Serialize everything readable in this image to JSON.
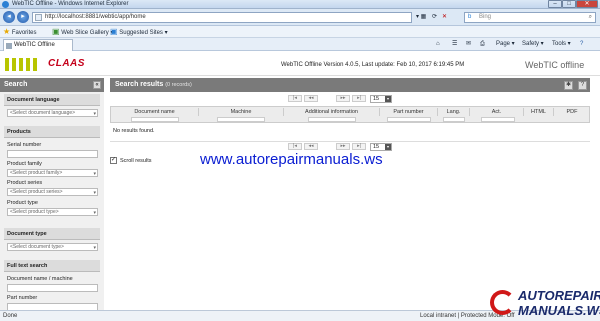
{
  "browser": {
    "title": "WebTIC Offline - Windows Internet Explorer",
    "url": "http://localhost:8881/webtic/app/home",
    "search_placeholder": "Bing",
    "favorites_label": "Favorites",
    "fav_items": [
      "Web Slice Gallery ▾",
      "Suggested Sites ▾"
    ],
    "tab_label": "WebTIC Offline",
    "tools": [
      "Page ▾",
      "Safety ▾",
      "Tools ▾",
      "?"
    ],
    "status_left": "Done",
    "status_right": "Local intranet | Protected Mode: Off"
  },
  "app": {
    "brand": "CLAAS",
    "version_line": "WebTIC Offline Version 4.0.5, Last update: Feb 10, 2017 6:19:45 PM",
    "product_name": "WebTIC offline"
  },
  "sidebar": {
    "title": "Search",
    "collapse_btn": "«",
    "sections": {
      "doc_language": {
        "title": "Document language",
        "select": "<Select document language>"
      },
      "products": {
        "title": "Products",
        "serial_label": "Serial number",
        "family_label": "Product family",
        "family_select": "<Select product family>",
        "series_label": "Product series",
        "series_select": "<Select product series>",
        "type_label": "Product type",
        "type_select": "<Select product type>"
      },
      "doc_type": {
        "title": "Document type",
        "select": "<Select document type>"
      },
      "fulltext": {
        "title": "Full text search",
        "docname_label": "Document name / machine",
        "part_label": "Part number"
      }
    }
  },
  "results": {
    "title": "Search results",
    "count": "(0 records)",
    "page_size": "15",
    "pager_buttons": [
      "|◂",
      "◂◂",
      "▸▸",
      "▸|"
    ],
    "columns": [
      "Document name",
      "Machine",
      "Additional information",
      "Part number",
      "Lang.",
      "Act.",
      "HTML",
      "PDF"
    ],
    "empty_text": "No results found.",
    "scroll_label": "Scroll results",
    "scroll_checked": "✓"
  },
  "watermark": {
    "url_text": "www.autorepairmanuals.ws",
    "logo_line1": "AUTOREPAIR",
    "logo_line2": "MANUALS.WS"
  }
}
